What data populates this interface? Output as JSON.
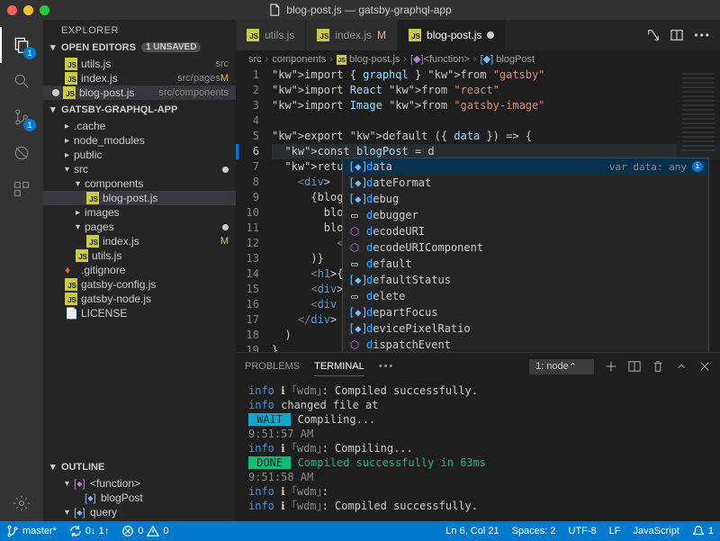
{
  "window_title": "blog-post.js — gatsby-graphql-app",
  "activity": {
    "explorer_badge": "1",
    "scm_badge": "1"
  },
  "sidebar": {
    "title": "EXPLORER",
    "open_editors": {
      "label": "OPEN EDITORS",
      "unsaved_label": "1 UNSAVED",
      "items": [
        {
          "name": "utils.js",
          "path": "src",
          "modified": false
        },
        {
          "name": "index.js",
          "path": "src/pages",
          "modified": true,
          "m_char": "M"
        },
        {
          "name": "blog-post.js",
          "path": "src/components",
          "modified": true,
          "dot": true
        }
      ]
    },
    "project": {
      "label": "GATSBY-GRAPHQL-APP",
      "tree": [
        {
          "type": "folder",
          "name": ".cache",
          "expanded": false,
          "indent": 0
        },
        {
          "type": "folder",
          "name": "node_modules",
          "expanded": false,
          "indent": 0
        },
        {
          "type": "folder",
          "name": "public",
          "expanded": false,
          "indent": 0
        },
        {
          "type": "folder",
          "name": "src",
          "expanded": true,
          "indent": 0,
          "dot": true
        },
        {
          "type": "folder",
          "name": "components",
          "expanded": true,
          "indent": 1
        },
        {
          "type": "file",
          "name": "blog-post.js",
          "indent": 2,
          "active": true,
          "js": true
        },
        {
          "type": "folder",
          "name": "images",
          "expanded": false,
          "indent": 1
        },
        {
          "type": "folder",
          "name": "pages",
          "expanded": true,
          "indent": 1,
          "dot": true
        },
        {
          "type": "file",
          "name": "index.js",
          "indent": 2,
          "js": true,
          "m": "M"
        },
        {
          "type": "file",
          "name": "utils.js",
          "indent": 1,
          "js": true
        },
        {
          "type": "file",
          "name": ".gitignore",
          "indent": 0,
          "git": true
        },
        {
          "type": "file",
          "name": "gatsby-config.js",
          "indent": 0,
          "js": true
        },
        {
          "type": "file",
          "name": "gatsby-node.js",
          "indent": 0,
          "js": true
        },
        {
          "type": "file",
          "name": "LICENSE",
          "indent": 0
        }
      ]
    },
    "outline": {
      "label": "OUTLINE",
      "items": [
        {
          "name": "<function>",
          "indent": 0,
          "kind": "func"
        },
        {
          "name": "blogPost",
          "indent": 1,
          "kind": "var"
        },
        {
          "name": "query",
          "indent": 0,
          "kind": "var"
        }
      ]
    }
  },
  "tabs": [
    {
      "label": "utils.js",
      "active": false
    },
    {
      "label": "index.js",
      "active": false,
      "modified": "M"
    },
    {
      "label": "blog-post.js",
      "active": true,
      "dirty": true
    }
  ],
  "breadcrumb": [
    "src",
    "components",
    "blog-post.js",
    "<function>",
    "blogPost"
  ],
  "code": {
    "lines": [
      "import { graphql } from \"gatsby\"",
      "import React from \"react\"",
      "import Image from \"gatsby-image\"",
      "",
      "export default ({ data }) => {",
      "  const blogPost = d",
      "  return (",
      "    <div>",
      "      {blogP",
      "        blog",
      "        blog",
      "          <I",
      "      )}",
      "      <h1>{b",
      "      <div>P",
      "      <div d",
      "    </div>",
      "  )",
      "}",
      ""
    ],
    "active_line": 6
  },
  "suggest": {
    "detail": "var data: any",
    "items": [
      {
        "label": "data",
        "kind": "var",
        "selected": true
      },
      {
        "label": "dateFormat",
        "kind": "var"
      },
      {
        "label": "debug",
        "kind": "var"
      },
      {
        "label": "debugger",
        "kind": "keyword"
      },
      {
        "label": "decodeURI",
        "kind": "func"
      },
      {
        "label": "decodeURIComponent",
        "kind": "func"
      },
      {
        "label": "default",
        "kind": "keyword"
      },
      {
        "label": "defaultStatus",
        "kind": "var"
      },
      {
        "label": "delete",
        "kind": "keyword"
      },
      {
        "label": "departFocus",
        "kind": "var"
      },
      {
        "label": "devicePixelRatio",
        "kind": "var"
      },
      {
        "label": "dispatchEvent",
        "kind": "func"
      }
    ]
  },
  "panel": {
    "tabs": {
      "problems": "PROBLEMS",
      "terminal": "TERMINAL"
    },
    "terminal_select": "1: node",
    "lines": [
      {
        "parts": [
          {
            "t": "info",
            "c": "cyan"
          },
          {
            "t": " ℹ "
          },
          {
            "t": "｢wdm｣",
            "c": "gray"
          },
          {
            "t": ": Compiled successfully."
          }
        ]
      },
      {
        "parts": [
          {
            "t": "info",
            "c": "cyan"
          },
          {
            "t": " changed file at"
          }
        ]
      },
      {
        "parts": [
          {
            "t": " WAIT ",
            "c": "cyanbg"
          },
          {
            "t": " Compiling..."
          }
        ]
      },
      {
        "parts": [
          {
            "t": "9:51:57 AM",
            "c": "gray"
          }
        ]
      },
      {
        "parts": [
          {
            "t": ""
          }
        ]
      },
      {
        "parts": [
          {
            "t": "info",
            "c": "cyan"
          },
          {
            "t": " ℹ "
          },
          {
            "t": "｢wdm｣",
            "c": "gray"
          },
          {
            "t": ": Compiling..."
          }
        ]
      },
      {
        "parts": [
          {
            "t": " DONE ",
            "c": "greenbg"
          },
          {
            "t": " Compiled successfully in 63ms",
            "c": "green"
          }
        ]
      },
      {
        "parts": [
          {
            "t": "9:51:58 AM",
            "c": "gray"
          }
        ]
      },
      {
        "parts": [
          {
            "t": ""
          }
        ]
      },
      {
        "parts": [
          {
            "t": "info",
            "c": "cyan"
          },
          {
            "t": " ℹ "
          },
          {
            "t": "｢wdm｣",
            "c": "gray"
          },
          {
            "t": ":"
          }
        ]
      },
      {
        "parts": [
          {
            "t": "info",
            "c": "cyan"
          },
          {
            "t": " ℹ "
          },
          {
            "t": "｢wdm｣",
            "c": "gray"
          },
          {
            "t": ": Compiled successfully."
          }
        ]
      }
    ]
  },
  "status": {
    "branch": "master*",
    "sync": "0↓ 1↑",
    "errors": "0",
    "warnings": "0",
    "cursor": "Ln 6, Col 21",
    "spaces": "Spaces: 2",
    "encoding": "UTF-8",
    "eol": "LF",
    "lang": "JavaScript",
    "feedback": "1"
  }
}
